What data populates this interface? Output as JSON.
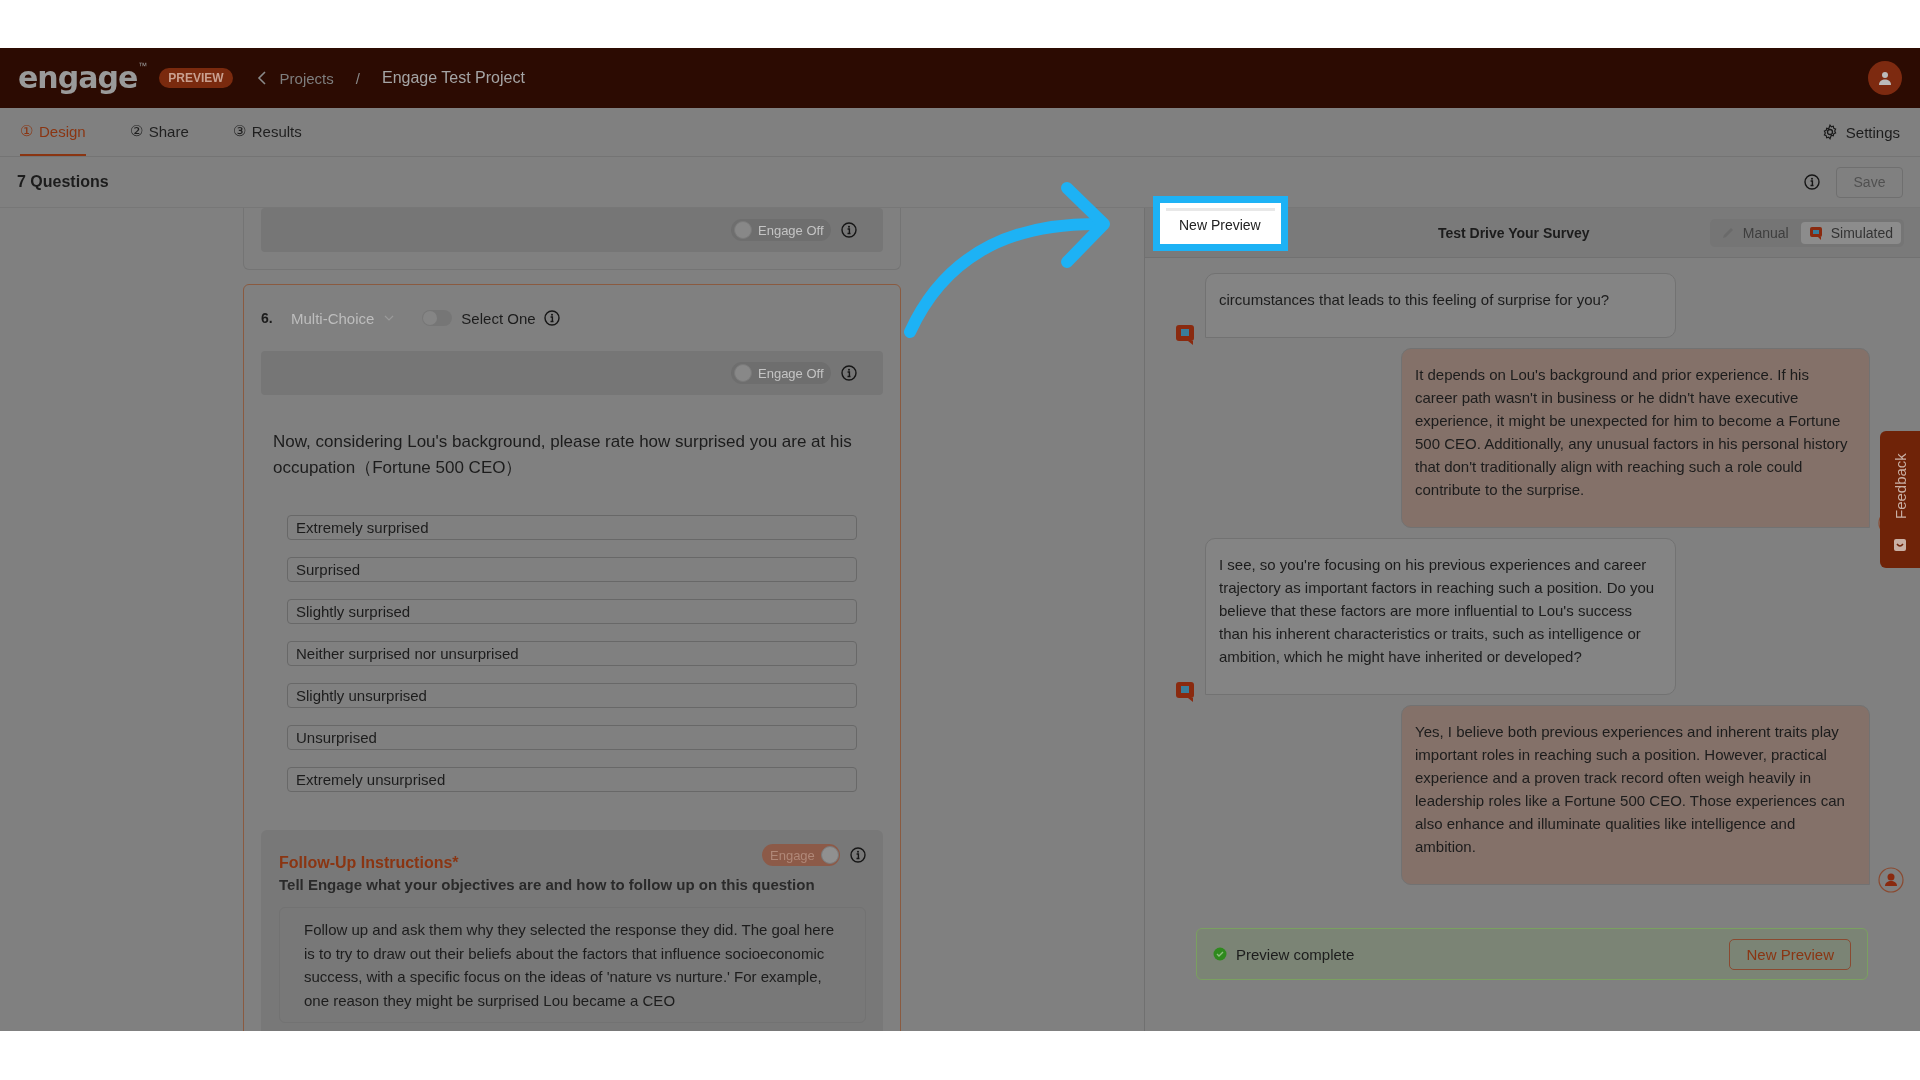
{
  "header": {
    "logo": "engage",
    "logo_mark": "™",
    "badge": "PREVIEW",
    "back_link": "Projects",
    "separator": "/",
    "project": "Engage Test Project"
  },
  "tabs": [
    {
      "icon": "①",
      "label": "Design",
      "selected": true
    },
    {
      "icon": "②",
      "label": "Share",
      "selected": false
    },
    {
      "icon": "③",
      "label": "Results",
      "selected": false
    }
  ],
  "settings": "Settings",
  "toolbar": {
    "title": "7 Questions",
    "save": {
      "label": "Save",
      "disabled": true
    }
  },
  "editor": {
    "previous_card": {
      "engage_toggle": {
        "label": "Engage Off",
        "on": false
      }
    },
    "question": {
      "number": "6.",
      "type": "Multi-Choice",
      "select_one": {
        "label": "Select One",
        "on": false
      },
      "engage_toggle": {
        "label": "Engage Off",
        "on": false
      },
      "text": "Now, considering Lou's background, please rate how surprised you are at his occupation（Fortune 500 CEO）",
      "options": [
        "Extremely surprised",
        "Surprised",
        "Slightly surprised",
        "Neither surprised nor unsurprised",
        "Slightly unsurprised",
        "Unsurprised",
        "Extremely unsurprised"
      ],
      "follow_up": {
        "title": "Follow-Up Instructions*",
        "subtitle": "Tell Engage what your objectives are and how to follow up on this question",
        "toggle": {
          "label": "Engage",
          "on": true
        },
        "instructions": "Follow up and ask them why they selected the response they did. The goal here is to try to draw out their beliefs about the factors that influence socioeconomic success, with a specific focus on the ideas of 'nature vs nurture.' For example, one reason they might be surprised Lou became a CEO"
      }
    }
  },
  "preview": {
    "highlighted_button": "New Preview",
    "title": "Test Drive Your Survey",
    "modes": [
      {
        "label": "Manual",
        "selected": false
      },
      {
        "label": "Simulated",
        "selected": true
      }
    ],
    "messages": [
      {
        "kind": "bot",
        "text": "circumstances that leads to this feeling of surprise for you?"
      },
      {
        "kind": "user",
        "text": "It depends on Lou's background and prior experience. If his career path wasn't in business or he didn't have executive experience, it might be unexpected for him to become a Fortune 500 CEO. Additionally, any unusual factors in his personal history that don't traditionally align with reaching such a role could contribute to the surprise."
      },
      {
        "kind": "bot",
        "text": "I see, so you're focusing on his previous experiences and career trajectory as important factors in reaching such a position. Do you believe that these factors are more influential to Lou's success than his inherent characteristics or traits, such as intelligence or ambition, which he might have inherited or developed?"
      },
      {
        "kind": "user",
        "text": "Yes, I believe both previous experiences and inherent traits play important roles in reaching such a position. However, practical experience and a proven track record often weigh heavily in leadership roles like a Fortune 500 CEO. Those experiences can also enhance and illuminate qualities like intelligence and ambition."
      }
    ],
    "status": {
      "text": "Preview complete",
      "button": "New Preview"
    },
    "feedback": "Feedback"
  }
}
